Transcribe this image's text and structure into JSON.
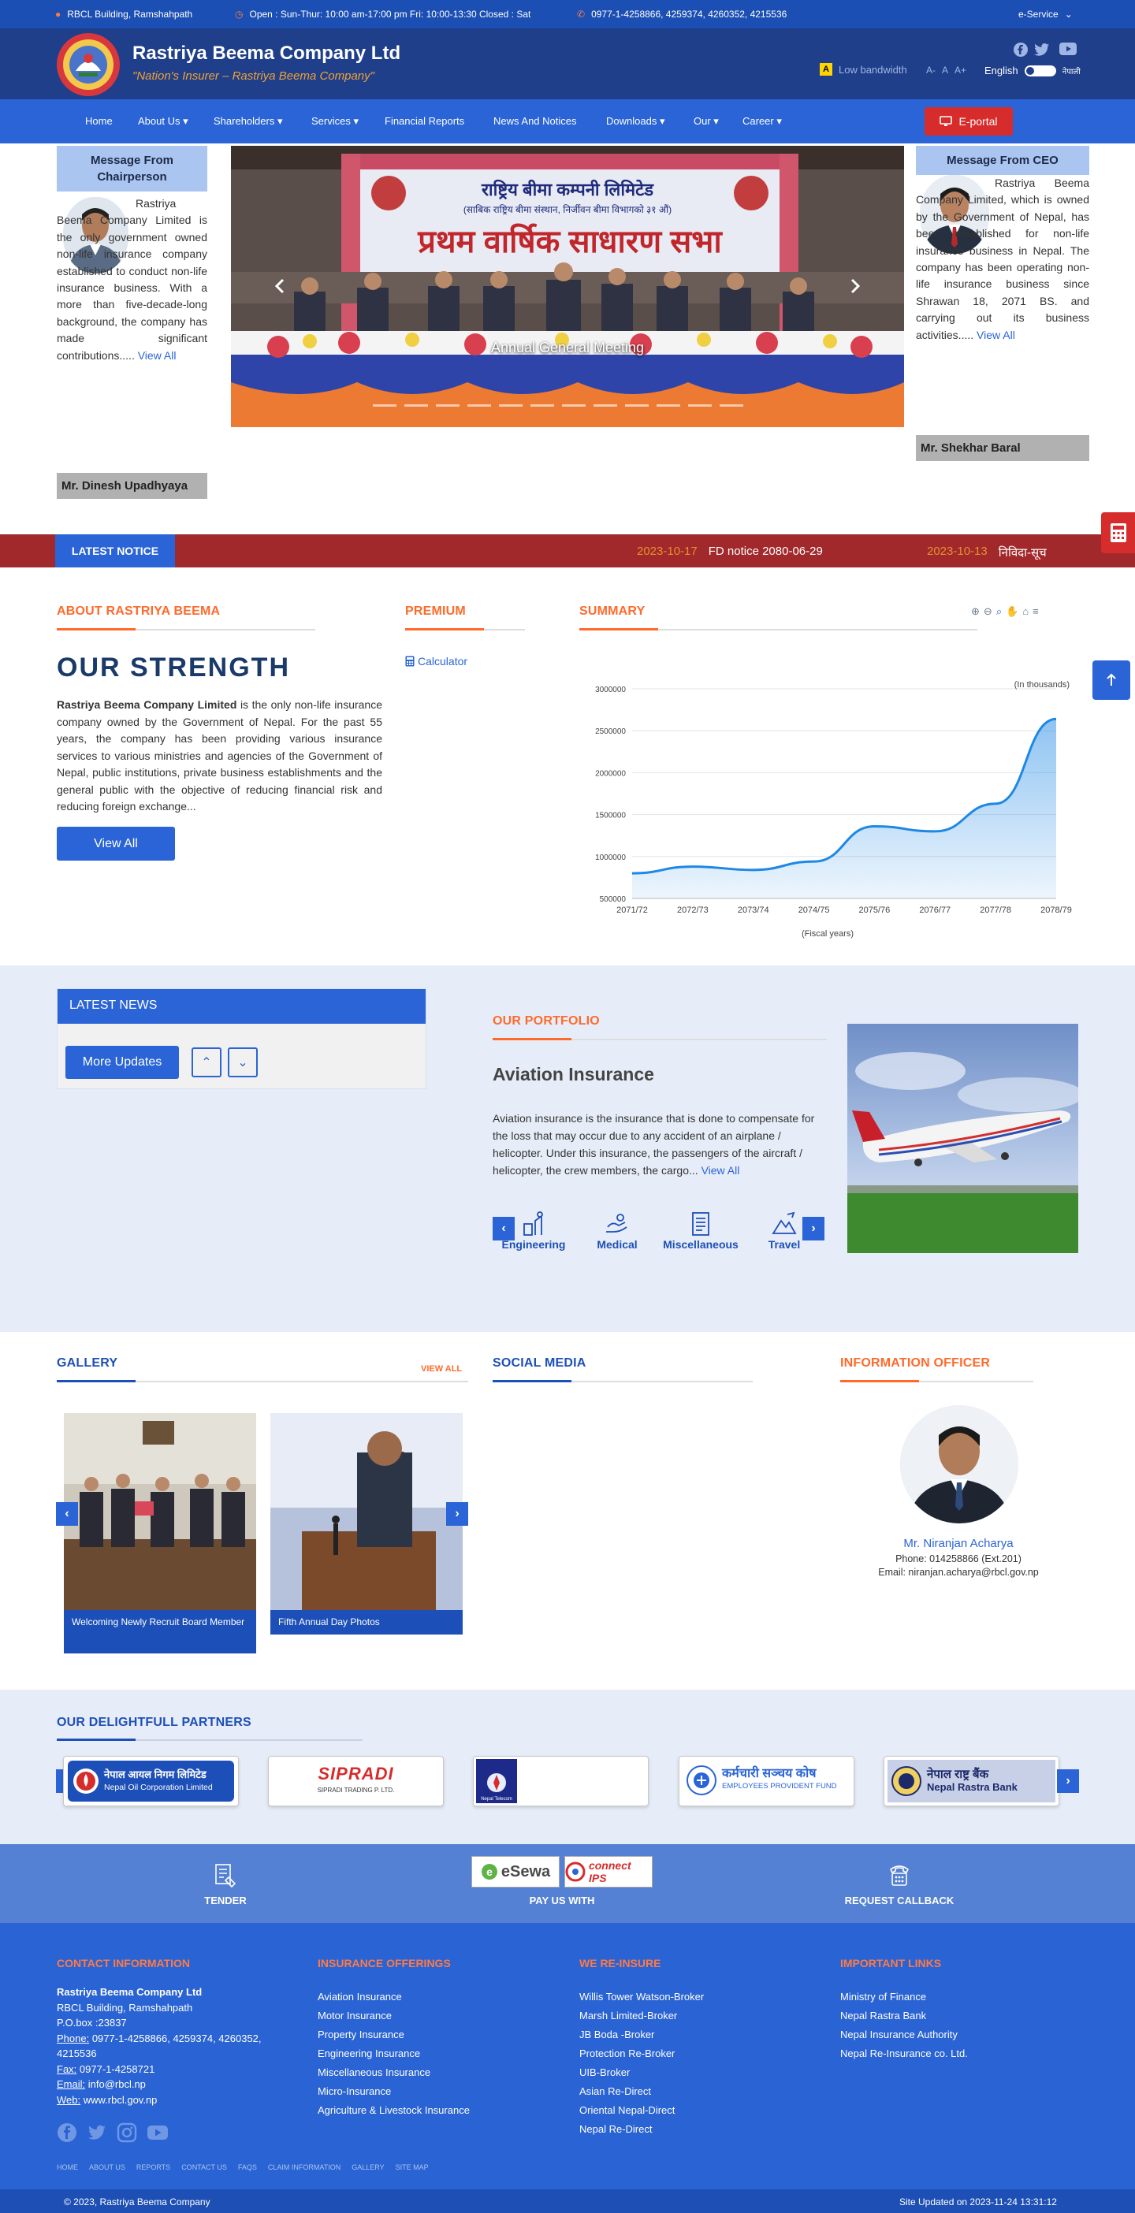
{
  "topbar": {
    "address": "RBCL Building, Ramshahpath",
    "hours": "Open : Sun-Thur: 10:00 am-17:00 pm Fri: 10:00-13:30 Closed : Sat",
    "phone": "0977-1-4258866, 4259374, 4260352, 4215536",
    "eservice": "e-Service"
  },
  "header": {
    "title": "Rastriya Beema Company Ltd",
    "tagline": "\"Nation's Insurer – Rastriya Beema Company\"",
    "low_bandwidth_badge": "A",
    "low_bandwidth": "Low bandwidth",
    "font_small": "A-",
    "font_normal": "A",
    "font_large": "A+",
    "lang_en": "English",
    "lang_np": "नेपाली",
    "social_icons": [
      "facebook-icon",
      "twitter-icon",
      "youtube-icon"
    ]
  },
  "nav": {
    "items": [
      "Home",
      "About Us",
      "Shareholders",
      "Services",
      "Financial Reports",
      "News And Notices",
      "Downloads",
      "Our",
      "Career"
    ],
    "eportal": "E-portal"
  },
  "chairperson": {
    "heading": "Message From Chairperson",
    "text": "Rastriya Beema Company Limited is the only government owned non-life insurance company established to conduct non-life insurance business. With a more than five-decade-long background, the company has made significant contributions.....",
    "link": "View All",
    "name": "Mr. Dinesh Upadhyaya"
  },
  "ceo": {
    "heading": "Message From CEO",
    "text": "Rastriya Beema Company Limited, which is owned by the Government of Nepal, has been established for non-life insurance business in Nepal. The company has been operating non-life insurance business since Shrawan 18, 2071 BS. and carrying out its business activities.....",
    "link": "View All",
    "name": "Mr. Shekhar Baral"
  },
  "slider": {
    "banner_line1": "राष्ट्रिय बीमा कम्पनी लिमिटेड",
    "banner_line2": "(साबिक राष्ट्रिय बीमा संस्थान, निर्जीवन बीमा विभागको ३१ औं)",
    "banner_line3": "प्रथम वार्षिक साधारण सभा",
    "caption": "Annual General Meeting"
  },
  "notice": {
    "label": "LATEST NOTICE",
    "items": [
      {
        "date": "2023-10-17",
        "title": "FD notice 2080-06-29"
      },
      {
        "date": "2023-10-13",
        "title": "निविदा-सूच"
      }
    ]
  },
  "about": {
    "heading": "ABOUT RASTRIYA BEEMA",
    "title": "OUR STRENGTH",
    "lead": "Rastriya Beema Company Limited",
    "text": " is the only non-life insurance company owned by the Government of Nepal. For the past 55 years, the company has been providing various insurance services to various ministries and agencies of the Government of Nepal, public institutions, private business establishments and the general public with the objective of reducing financial risk and reducing foreign exchange...",
    "button": "View All"
  },
  "premium": {
    "heading": "PREMIUM",
    "calculator": "Calculator"
  },
  "summary": {
    "heading": "SUMMARY",
    "toolbar_icons": [
      "zoom-in-icon",
      "zoom-out-icon",
      "magnify-icon",
      "pan-icon",
      "home-icon",
      "menu-icon"
    ]
  },
  "chart_data": {
    "type": "area",
    "categories": [
      "2071/72",
      "2072/73",
      "2073/74",
      "2074/75",
      "2075/76",
      "2076/77",
      "2077/78",
      "2078/79"
    ],
    "series": [
      {
        "values": [
          800000,
          880000,
          840000,
          940000,
          1360000,
          1300000,
          1630000,
          2640000
        ]
      }
    ],
    "yticks": [
      500000,
      1000000,
      1500000,
      2000000,
      2500000,
      3000000
    ],
    "ylim": [
      500000,
      3000000
    ],
    "unit_label": "(In thousands)",
    "xlabel": "(Fiscal years)",
    "ylabel": "",
    "grid": true,
    "color": "#1e88e5"
  },
  "news": {
    "heading": "LATEST NEWS",
    "button": "More Updates"
  },
  "portfolio": {
    "heading": "OUR PORTFOLIO",
    "title": "Aviation Insurance",
    "text": "Aviation insurance is the insurance that is done to compensate for the loss that may occur due to any accident of an airplane / helicopter. Under this insurance, the passengers of the aircraft / helicopter, the crew members, the cargo...",
    "link": "View All",
    "tabs": [
      "Engineering",
      "Medical",
      "Miscellaneous",
      "Travel"
    ]
  },
  "gallery": {
    "heading": "GALLERY",
    "view_all": "VIEW ALL",
    "items": [
      "Welcoming Newly Recruit Board Member",
      "Fifth Annual Day Photos"
    ]
  },
  "social": {
    "heading": "SOCIAL MEDIA"
  },
  "info_officer": {
    "heading": "INFORMATION OFFICER",
    "name": "Mr. Niranjan Acharya",
    "phone": "Phone: 014258866 (Ext.201)",
    "email": "Email: niranjan.acharya@rbcl.gov.np"
  },
  "partners": {
    "heading": "OUR DELIGHTFULL PARTNERS",
    "items": [
      {
        "name": "नेपाल आयल निगम लिमिटेड",
        "sub": "Nepal Oil Corporation Limited"
      },
      {
        "name": "SIPRADI",
        "sub": "SIPRADI TRADING P. LTD."
      },
      {
        "name": "Nepal Telecom",
        "sub": ""
      },
      {
        "name": "कर्मचारी सञ्चय कोष",
        "sub": "EMPLOYEES PROVIDENT FUND"
      },
      {
        "name": "नेपाल राष्ट्र बैंक",
        "sub": "Nepal Rastra Bank"
      }
    ]
  },
  "paybar": {
    "tender": "TENDER",
    "paywith": "PAY US WITH",
    "esewa": "eSewa",
    "connectips": "connect IPS",
    "callback": "REQUEST CALLBACK"
  },
  "footer": {
    "contact_heading": "CONTACT INFORMATION",
    "company": "Rastriya Beema Company Ltd",
    "address": "RBCL Building, Ramshahpath",
    "pobox": "P.O.box :23837",
    "phone_label": "Phone:",
    "phone": " 0977-1-4258866, 4259374, 4260352, 4215536",
    "fax_label": "Fax:",
    "fax": " 0977-1-4258721",
    "email_label": "Email:",
    "email": " info@rbcl.np",
    "web_label": "Web:",
    "web": " www.rbcl.gov.np",
    "offerings_heading": "INSURANCE OFFERINGS",
    "offerings": [
      "Aviation Insurance",
      "Motor Insurance",
      "Property Insurance",
      "Engineering Insurance",
      "Miscellaneous Insurance",
      "Micro-Insurance",
      "Agriculture & Livestock Insurance"
    ],
    "reinsure_heading": "WE RE-INSURE",
    "reinsure": [
      "Willis Tower Watson-Broker",
      "Marsh Limited-Broker",
      "JB Boda -Broker",
      "Protection Re-Broker",
      "UIB-Broker",
      "Asian Re-Direct",
      "Oriental Nepal-Direct",
      "Nepal Re-Direct"
    ],
    "links_heading": "IMPORTANT LINKS",
    "links": [
      "Ministry of Finance",
      "Nepal Rastra Bank",
      "Nepal Insurance Authority",
      "Nepal Re-Insurance co. Ltd."
    ],
    "bottom_nav": [
      "HOME",
      "ABOUT US",
      "REPORTS",
      "CONTACT US",
      "FAQS",
      "CLAIM INFORMATION",
      "GALLERY",
      "SITE MAP"
    ],
    "copyright": "© 2023, Rastriya Beema Company",
    "updated": "Site Updated on 2023-11-24 13:31:12"
  }
}
